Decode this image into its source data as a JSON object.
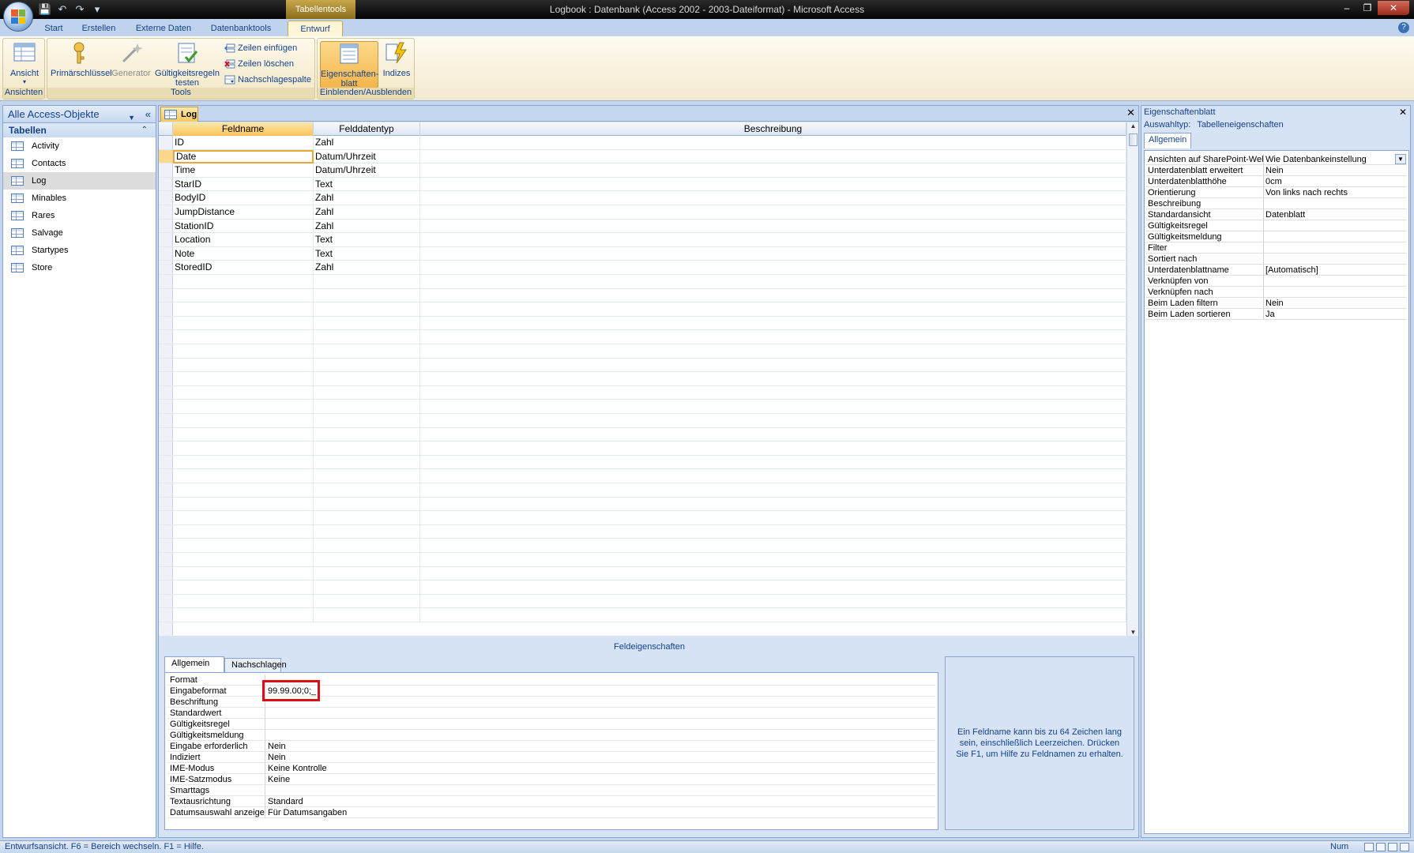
{
  "titlebar": {
    "context_tab": "Tabellentools",
    "title": "Logbook : Datenbank (Access 2002 - 2003-Dateiformat) - Microsoft Access"
  },
  "ribbon_tabs": [
    "Start",
    "Erstellen",
    "Externe Daten",
    "Datenbanktools",
    "Entwurf"
  ],
  "ribbon": {
    "ansicht_label": "Ansicht",
    "ansichten_group": "Ansichten",
    "primaerschluessel": "Primärschlüssel",
    "generator": "Generator",
    "gueltigkeit_line1": "Gültigkeitsregeln",
    "gueltigkeit_line2": "testen",
    "zeilen_einfuegen": "Zeilen einfügen",
    "zeilen_loeschen": "Zeilen löschen",
    "nachschlagespalte": "Nachschlagespalte",
    "tools_group": "Tools",
    "eigenschaften_line1": "Eigenschaften-",
    "eigenschaften_line2": "blatt",
    "indizes": "Indizes",
    "einblenden_group": "Einblenden/Ausblenden"
  },
  "nav": {
    "header": "Alle Access-Objekte",
    "group": "Tabellen",
    "items": [
      "Activity",
      "Contacts",
      "Log",
      "Minables",
      "Rares",
      "Salvage",
      "Startypes",
      "Store"
    ],
    "selected": "Log"
  },
  "doc": {
    "tab": "Log",
    "headers": {
      "feldname": "Feldname",
      "felddatentyp": "Felddatentyp",
      "beschreibung": "Beschreibung"
    },
    "rows": [
      {
        "name": "ID",
        "type": "Zahl"
      },
      {
        "name": "Date",
        "type": "Datum/Uhrzeit"
      },
      {
        "name": "Time",
        "type": "Datum/Uhrzeit"
      },
      {
        "name": "StarID",
        "type": "Text"
      },
      {
        "name": "BodyID",
        "type": "Zahl"
      },
      {
        "name": "JumpDistance",
        "type": "Zahl"
      },
      {
        "name": "StationID",
        "type": "Zahl"
      },
      {
        "name": "Location",
        "type": "Text"
      },
      {
        "name": "Note",
        "type": "Text"
      },
      {
        "name": "StoredID",
        "type": "Zahl"
      }
    ],
    "current_row": "Date"
  },
  "field_props": {
    "title": "Feldeigenschaften",
    "tab_general": "Allgemein",
    "tab_lookup": "Nachschlagen",
    "rows": [
      {
        "k": "Format",
        "v": ""
      },
      {
        "k": "Eingabeformat",
        "v": "99.99.00;0;_"
      },
      {
        "k": "Beschriftung",
        "v": ""
      },
      {
        "k": "Standardwert",
        "v": ""
      },
      {
        "k": "Gültigkeitsregel",
        "v": ""
      },
      {
        "k": "Gültigkeitsmeldung",
        "v": ""
      },
      {
        "k": "Eingabe erforderlich",
        "v": "Nein"
      },
      {
        "k": "Indiziert",
        "v": "Nein"
      },
      {
        "k": "IME-Modus",
        "v": "Keine Kontrolle"
      },
      {
        "k": "IME-Satzmodus",
        "v": "Keine"
      },
      {
        "k": "Smarttags",
        "v": ""
      },
      {
        "k": "Textausrichtung",
        "v": "Standard"
      },
      {
        "k": "Datumsauswahl anzeigen",
        "v": "Für Datumsangaben"
      }
    ],
    "hint": "Ein Feldname kann bis zu 64 Zeichen lang sein, einschließlich Leerzeichen. Drücken Sie F1, um Hilfe zu Feldnamen zu erhalten."
  },
  "property_sheet": {
    "title": "Eigenschaftenblatt",
    "selection_label": "Auswahltyp:",
    "selection_value": "Tabelleneigenschaften",
    "tab": "Allgemein",
    "rows": [
      {
        "k": "Ansichten auf SharePoint-Website anzeigen",
        "v": "Wie Datenbankeinstellung"
      },
      {
        "k": "Unterdatenblatt erweitert",
        "v": "Nein"
      },
      {
        "k": "Unterdatenblatthöhe",
        "v": "0cm"
      },
      {
        "k": "Orientierung",
        "v": "Von links nach rechts"
      },
      {
        "k": "Beschreibung",
        "v": ""
      },
      {
        "k": "Standardansicht",
        "v": "Datenblatt"
      },
      {
        "k": "Gültigkeitsregel",
        "v": ""
      },
      {
        "k": "Gültigkeitsmeldung",
        "v": ""
      },
      {
        "k": "Filter",
        "v": ""
      },
      {
        "k": "Sortiert nach",
        "v": ""
      },
      {
        "k": "Unterdatenblattname",
        "v": "[Automatisch]"
      },
      {
        "k": "Verknüpfen von",
        "v": ""
      },
      {
        "k": "Verknüpfen nach",
        "v": ""
      },
      {
        "k": "Beim Laden filtern",
        "v": "Nein"
      },
      {
        "k": "Beim Laden sortieren",
        "v": "Ja"
      }
    ]
  },
  "status": {
    "text": "Entwurfsansicht. F6 = Bereich wechseln. F1 = Hilfe.",
    "num": "Num"
  },
  "colors": {
    "accent": "#15428b",
    "highlight": "#d9101a",
    "active_tab": "#f9c35a"
  }
}
